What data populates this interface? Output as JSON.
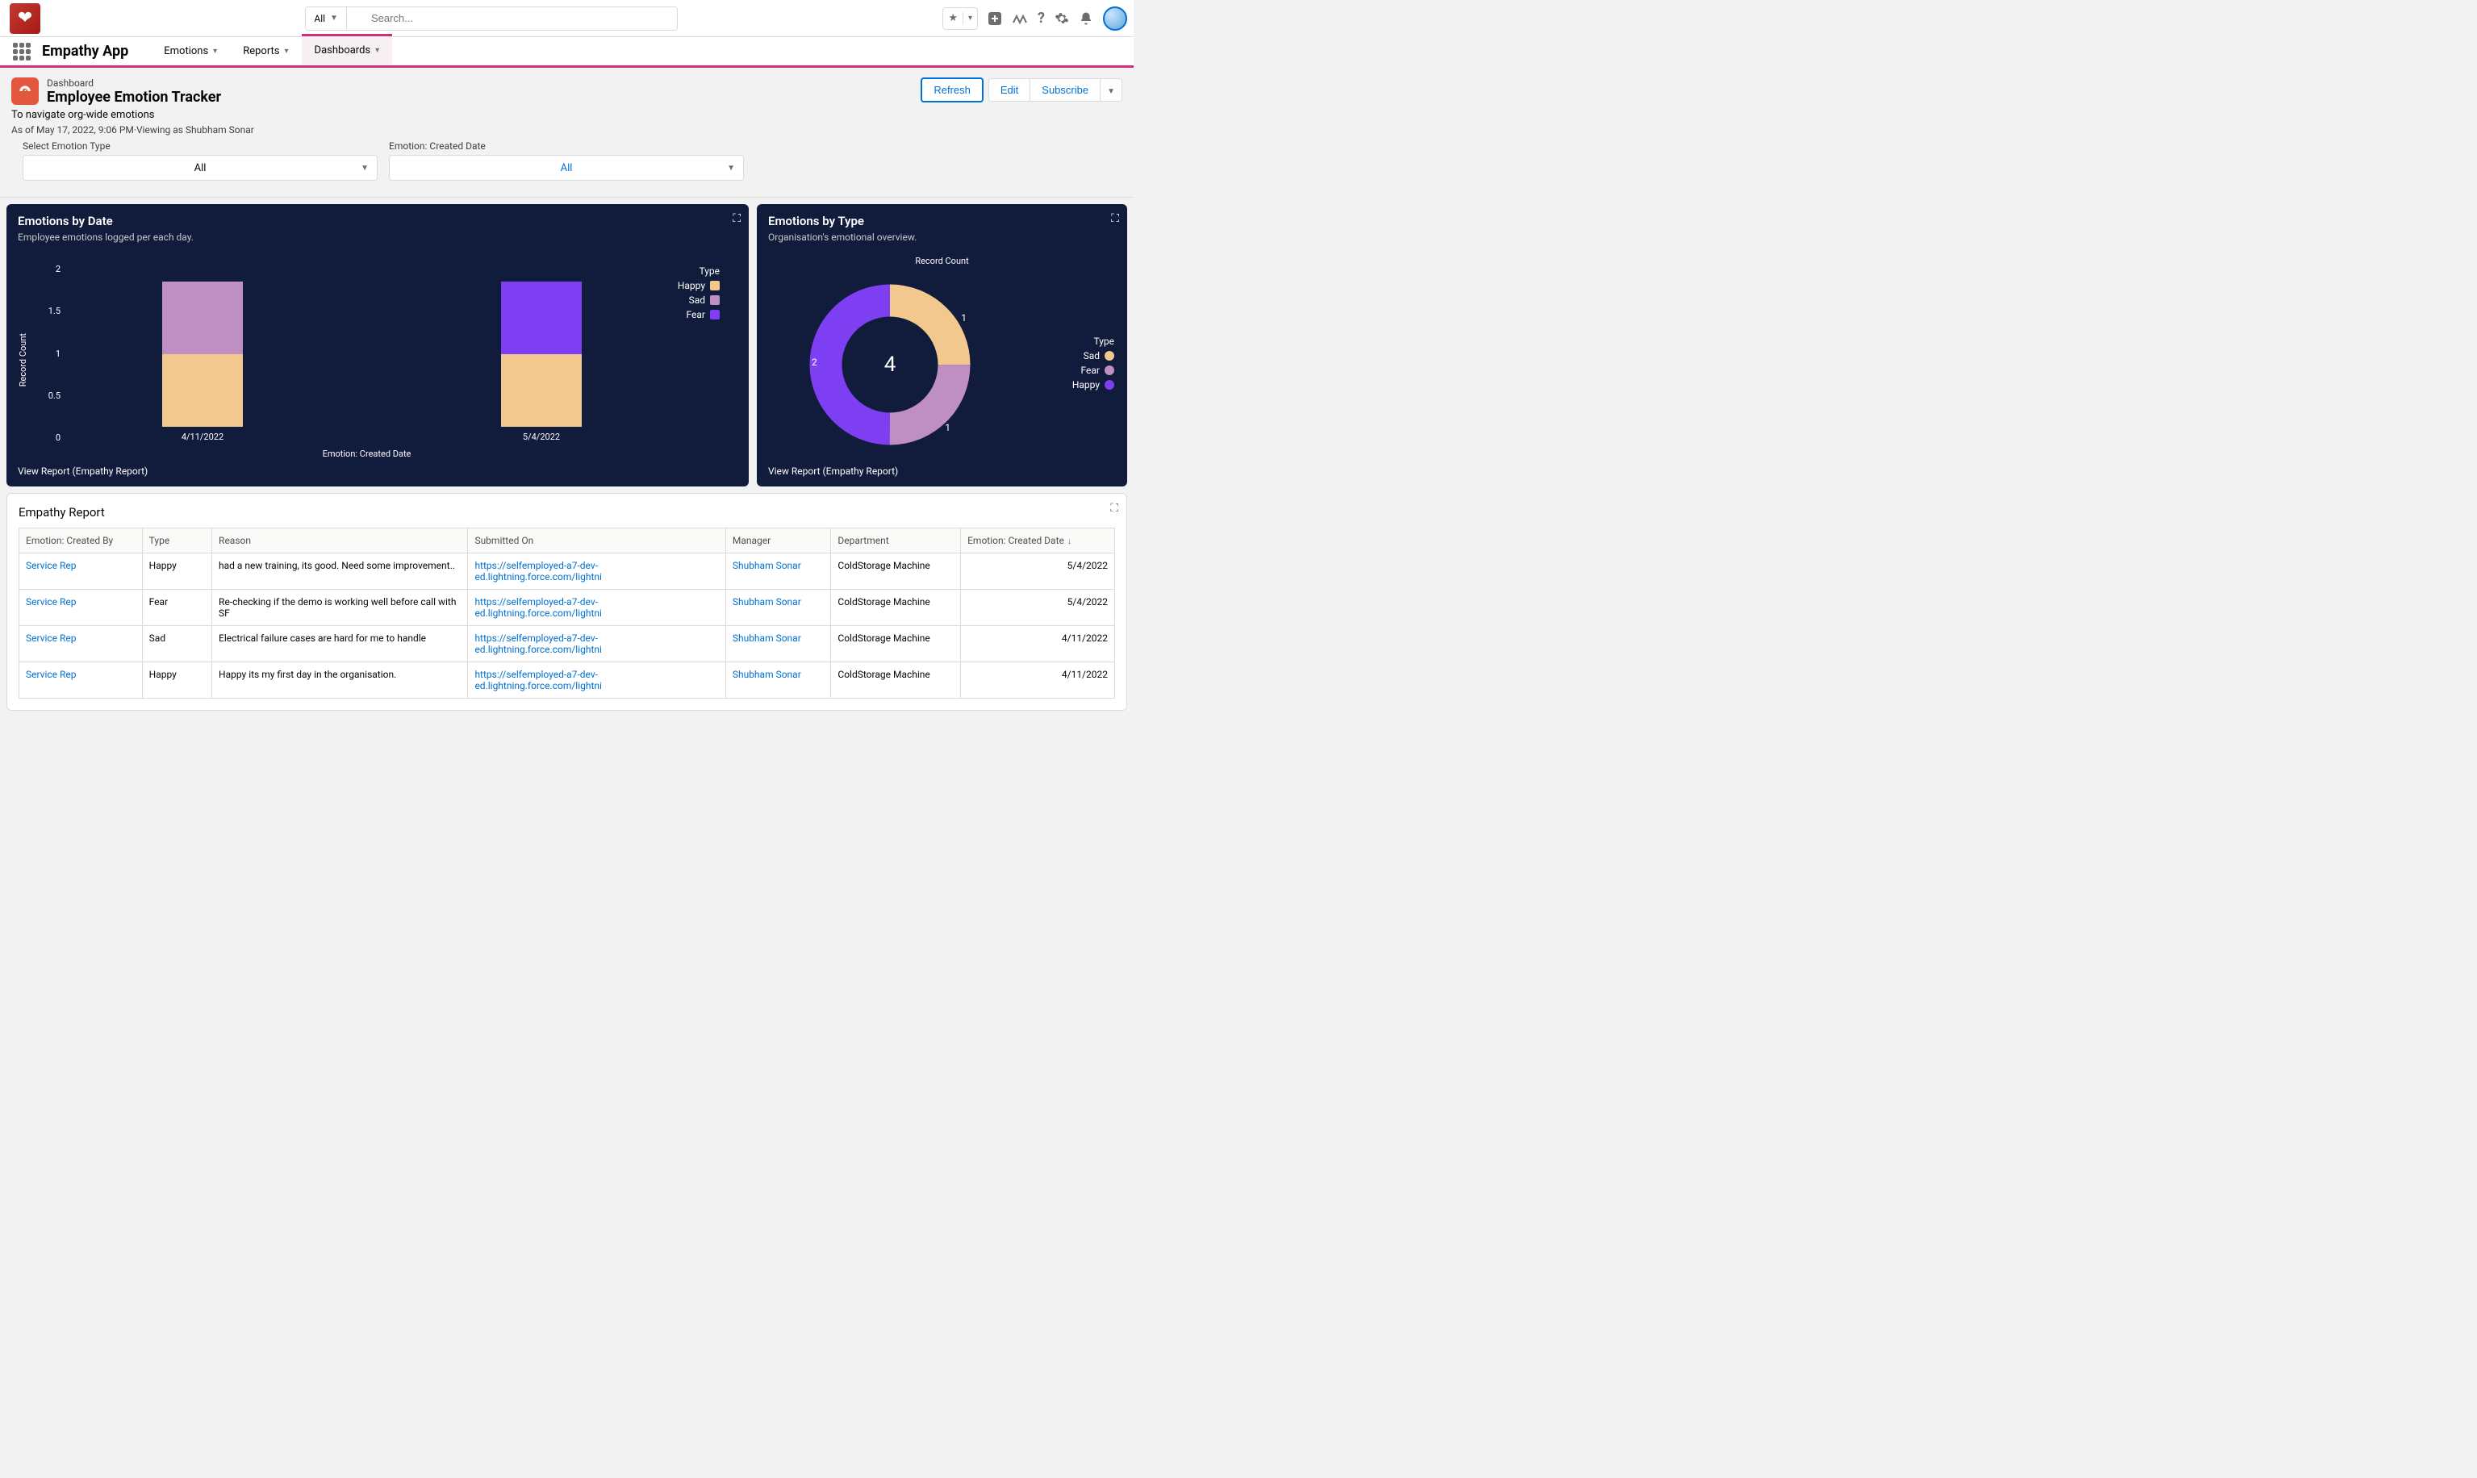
{
  "header": {
    "search_scope": "All",
    "search_placeholder": "Search..."
  },
  "nav": {
    "app_name": "Empathy App",
    "items": [
      {
        "label": "Emotions",
        "active": false
      },
      {
        "label": "Reports",
        "active": false
      },
      {
        "label": "Dashboards",
        "active": true
      }
    ]
  },
  "page": {
    "kind": "Dashboard",
    "title": "Employee Emotion Tracker",
    "subtitle": "To navigate org-wide emotions",
    "meta": "As of May 17, 2022, 9:06 PM·Viewing as Shubham Sonar",
    "actions": {
      "refresh": "Refresh",
      "edit": "Edit",
      "subscribe": "Subscribe"
    }
  },
  "filters": {
    "f1_label": "Select Emotion Type",
    "f1_value": "All",
    "f2_label": "Emotion: Created Date",
    "f2_value": "All"
  },
  "card_bar": {
    "title": "Emotions by Date",
    "subtitle": "Employee emotions logged per each day.",
    "legend_header": "Type",
    "legend": [
      "Happy",
      "Sad",
      "Fear"
    ],
    "y_label": "Record Count",
    "x_label": "Emotion: Created Date",
    "view_report": "View Report (Empathy Report)"
  },
  "card_donut": {
    "title": "Emotions by Type",
    "subtitle": "Organisation's emotional overview.",
    "center_label": "Record Count",
    "center_value": "4",
    "legend_header": "Type",
    "legend": [
      "Sad",
      "Fear",
      "Happy"
    ],
    "seg_labels": {
      "sad": "1",
      "fear": "1",
      "happy": "2"
    },
    "view_report": "View Report (Empathy Report)"
  },
  "report": {
    "title": "Empathy Report",
    "columns": [
      "Emotion: Created By",
      "Type",
      "Reason",
      "Submitted On",
      "Manager",
      "Department",
      "Emotion: Created Date"
    ],
    "rows": [
      {
        "created_by": "Service Rep",
        "type": "Happy",
        "reason": "had a new training, its good. Need some improvement..",
        "submitted_on": "https://selfemployed-a7-dev-ed.lightning.force.com/lightni",
        "manager": "Shubham Sonar",
        "department": "ColdStorage Machine",
        "created_date": "5/4/2022"
      },
      {
        "created_by": "Service Rep",
        "type": "Fear",
        "reason": "Re-checking if the demo is working well before call with SF",
        "submitted_on": "https://selfemployed-a7-dev-ed.lightning.force.com/lightni",
        "manager": "Shubham Sonar",
        "department": "ColdStorage Machine",
        "created_date": "5/4/2022"
      },
      {
        "created_by": "Service Rep",
        "type": "Sad",
        "reason": "Electrical failure cases are hard for me to handle",
        "submitted_on": "https://selfemployed-a7-dev-ed.lightning.force.com/lightni",
        "manager": "Shubham Sonar",
        "department": "ColdStorage Machine",
        "created_date": "4/11/2022"
      },
      {
        "created_by": "Service Rep",
        "type": "Happy",
        "reason": "Happy its my first day in the organisation.",
        "submitted_on": "https://selfemployed-a7-dev-ed.lightning.force.com/lightni",
        "manager": "Shubham Sonar",
        "department": "ColdStorage Machine",
        "created_date": "4/11/2022"
      }
    ]
  },
  "chart_data": [
    {
      "type": "bar",
      "stacked": true,
      "title": "Emotions by Date",
      "xlabel": "Emotion: Created Date",
      "ylabel": "Record Count",
      "categories": [
        "4/11/2022",
        "5/4/2022"
      ],
      "series": [
        {
          "name": "Happy",
          "values": [
            1,
            1
          ],
          "color": "#f3c88f"
        },
        {
          "name": "Sad",
          "values": [
            1,
            0
          ],
          "color": "#c08fc2"
        },
        {
          "name": "Fear",
          "values": [
            0,
            1
          ],
          "color": "#7e3ff2"
        }
      ],
      "ylim": [
        0,
        2
      ],
      "yticks": [
        0,
        0.5,
        1,
        1.5,
        2
      ]
    },
    {
      "type": "pie",
      "variant": "donut",
      "title": "Emotions by Type",
      "center_label": "Record Count",
      "total": 4,
      "series": [
        {
          "name": "Happy",
          "value": 2,
          "color": "#7e3ff2"
        },
        {
          "name": "Sad",
          "value": 1,
          "color": "#f3c88f"
        },
        {
          "name": "Fear",
          "value": 1,
          "color": "#c08fc2"
        }
      ]
    }
  ]
}
